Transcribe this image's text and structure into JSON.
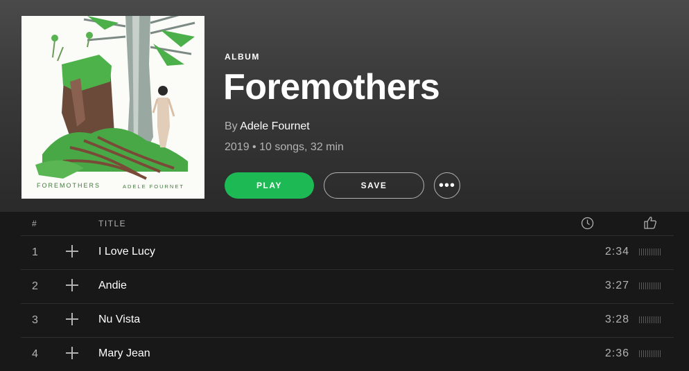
{
  "album": {
    "kind_label": "ALBUM",
    "title": "Foremothers",
    "by_prefix": "By",
    "artist": "Adele Fournet",
    "meta": "2019 • 10 songs, 32 min",
    "cover_text_title": "FOREMOTHERS",
    "cover_text_artist": "ADELE FOURNET"
  },
  "actions": {
    "play_label": "PLAY",
    "save_label": "SAVE",
    "more_label": "•••"
  },
  "table": {
    "col_number": "#",
    "col_title": "TITLE",
    "duration_icon": "clock-icon",
    "popularity_icon": "thumbs-up-icon",
    "rows": [
      {
        "number": "1",
        "title": "I Love Lucy",
        "duration": "2:34"
      },
      {
        "number": "2",
        "title": "Andie",
        "duration": "3:27"
      },
      {
        "number": "3",
        "title": "Nu Vista",
        "duration": "3:28"
      },
      {
        "number": "4",
        "title": "Mary Jean",
        "duration": "2:36"
      }
    ]
  },
  "colors": {
    "accent": "#1db954",
    "background": "#181818",
    "muted_text": "#b3b3b3"
  }
}
